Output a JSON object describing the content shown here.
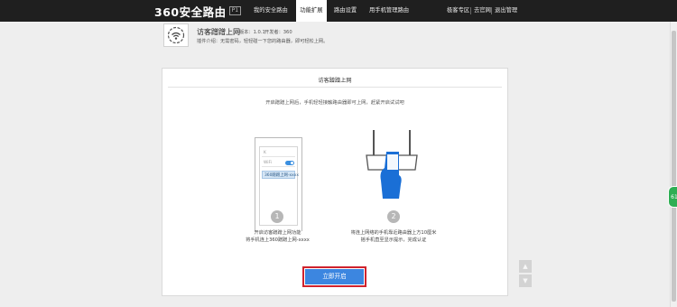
{
  "header": {
    "logo_text": "360安全路由",
    "logo_badge": "P1",
    "nav": [
      "我的安全路由",
      "功能扩展",
      "路由设置",
      "用手机管理路由"
    ],
    "active_nav_index": 1,
    "right_links": [
      "极客专区",
      "去官网",
      "退出管理"
    ]
  },
  "plugin": {
    "name": "访客蹭蹭上网",
    "version": "版本：1.0.1",
    "developer": "开发者：360",
    "description": "插件介绍：无需密码，轻轻碰一下您的路由器，即可轻松上网。"
  },
  "card": {
    "title": "访客蹭蹭上网",
    "desc": "开启蹭蹭上网后，手机轻轻接触路由器即可上网，赶紧开启试试吧",
    "phone_rows": {
      "row1": "K",
      "row2": "WiFi",
      "row3": "360蹭蹭上网-xxxx"
    },
    "step1": {
      "num": "1",
      "line1": "开启访客蹭蹭上网功能",
      "line2": "将手机连上360蹭蹭上网-xxxx"
    },
    "step2": {
      "num": "2",
      "line1": "将连上网络的手机靠近路由器上方10厘米",
      "line2": "摇手机直至显示提示，完成认证"
    },
    "cta_label": "立即开启"
  },
  "side": {
    "scroll_up": "▲",
    "scroll_down": "▼",
    "widget_text": "61"
  },
  "colors": {
    "topbar": "#1f1f1f",
    "accent": "#3c86e0",
    "highlight": "#d0232d",
    "widget": "#2fae54"
  }
}
